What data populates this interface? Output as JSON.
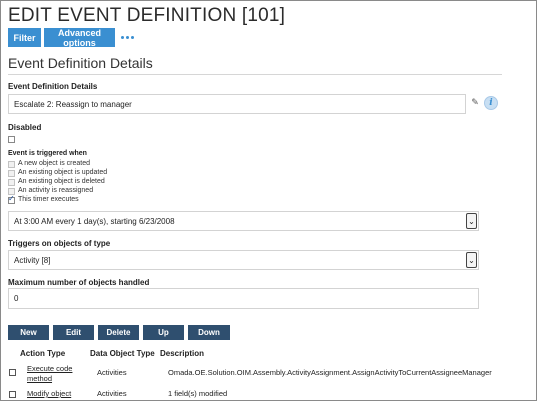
{
  "page": {
    "title": "EDIT EVENT DEFINITION [101]"
  },
  "toolbar": {
    "filter_label": "Filter",
    "advanced_label": "Advanced options",
    "more_icon": "ellipsis-icon"
  },
  "section": {
    "title": "Event Definition Details"
  },
  "form": {
    "details_label": "Event Definition Details",
    "details_value": "Escalate 2: Reassign to manager",
    "disabled_label": "Disabled",
    "disabled_checked": false,
    "trigger_label": "Event is triggered when",
    "trigger_options": [
      {
        "label": "A new object is created",
        "checked": false
      },
      {
        "label": "An existing object is updated",
        "checked": false
      },
      {
        "label": "An existing object is deleted",
        "checked": false
      },
      {
        "label": "An activity is reassigned",
        "checked": false
      },
      {
        "label": "This timer executes",
        "checked": true
      }
    ],
    "timer_value": "At 3:00 AM every 1 day(s), starting 6/23/2008",
    "object_type_label": "Triggers on objects of type",
    "object_type_value": "Activity [8]",
    "max_label": "Maximum number of objects handled",
    "max_value": "0"
  },
  "actions": {
    "new": "New",
    "edit": "Edit",
    "delete": "Delete",
    "up": "Up",
    "down": "Down"
  },
  "table": {
    "headers": {
      "action_type": "Action Type",
      "data_object_type": "Data Object Type",
      "description": "Description"
    },
    "rows": [
      {
        "action_type_line1": "Execute code",
        "action_type_line2": "method",
        "data_object_type": "Activities",
        "description": "Omada.OE.Solution.OIM.Assembly.ActivityAssignment.AssignActivityToCurrentAssigneeManager"
      },
      {
        "action_type_line1": "Modify object",
        "data_object_type": "Activities",
        "description": "1 field(s) modified"
      }
    ]
  },
  "colors": {
    "accent": "#3a8fd1",
    "dark_button": "#2f4f6f",
    "info_bg": "#c8dff3"
  }
}
